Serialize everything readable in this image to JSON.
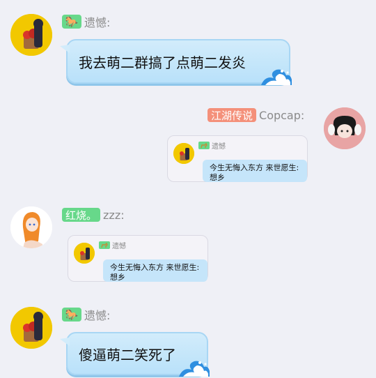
{
  "messages": [
    {
      "tag": "🐎",
      "name": "遗憾:",
      "text": "我去萌二群搞了点萌二发炎"
    },
    {
      "tag": "江湖传说",
      "name": "Copcap:",
      "quote": {
        "tag": "🐎",
        "name": "遗憾",
        "text": "今生无悔入东方 来世愿生:\n想乡"
      }
    },
    {
      "tag": "红烧。",
      "name": "zzz:",
      "quote": {
        "tag": "🐎",
        "name": "遗憾",
        "text": "今生无悔入东方 来世愿生:\n想乡"
      }
    },
    {
      "tag": "🐎",
      "name": "遗憾:",
      "text": "傻逼萌二笑死了"
    }
  ],
  "colors": {
    "background": "#eff0f6",
    "bubble": "#c5e5fa",
    "tag_green": "#67d88a",
    "tag_salmon": "#f4907a"
  },
  "icons": [
    "horse-tag-icon",
    "wave-decoration-icon",
    "avatar-yellow",
    "avatar-pink",
    "avatar-anime"
  ]
}
